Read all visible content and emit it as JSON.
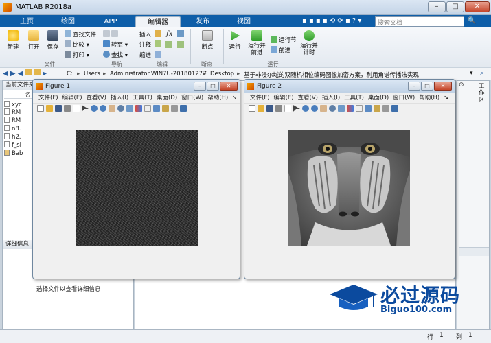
{
  "window": {
    "title": "MATLAB R2018a",
    "minimize": "–",
    "maximize": "□",
    "close": "✕"
  },
  "tabs": [
    "主页",
    "绘图",
    "APP",
    "编辑器",
    "发布",
    "视图"
  ],
  "search": {
    "placeholder": "搜索文档"
  },
  "ribbon": {
    "new": "新建",
    "open": "打开",
    "save": "保存",
    "find_files": "查找文件",
    "compare": "比较",
    "print": "打印",
    "goto": "转至",
    "find": "查找",
    "insert": "插入",
    "comment": "注释",
    "indent": "缩进",
    "breakpoints": "断点",
    "run": "运行",
    "run_advance": "运行并前进",
    "run_section": "运行节",
    "advance": "前进",
    "run_time": "运行并计时",
    "group_file": "文件",
    "group_navigate": "导航",
    "group_edit": "编辑",
    "group_breakpoints": "断点",
    "group_run": "运行"
  },
  "path": {
    "drive": "C:",
    "users": "Users",
    "admin": "Administrator.WIN7U-20180127Z",
    "desktop": "Desktop",
    "folder": "基于非浸尔域的双随机相位编码图像加密方案，利用角谱传播法实现"
  },
  "left_panel": {
    "header": "当前文件夹",
    "col_name": "名",
    "files": [
      "xyc",
      "RM",
      "RM",
      "n8.",
      "h2.",
      "f_si",
      "Bab"
    ],
    "details_header": "详细信息",
    "details_msg": "选择文件以查看详细信息"
  },
  "right_panel": {
    "label": "工作区"
  },
  "figure1": {
    "title": "Figure 1"
  },
  "figure2": {
    "title": "Figure 2"
  },
  "fig_menu": [
    "文件(F)",
    "编辑(E)",
    "查看(V)",
    "插入(I)",
    "工具(T)",
    "桌面(D)",
    "窗口(W)",
    "帮助(H)"
  ],
  "status": {
    "row_label": "行",
    "row": "1",
    "col_label": "列",
    "col": "1"
  },
  "watermark": {
    "name": "必过源码",
    "url": "Biguo100.com"
  },
  "colors": {
    "ribbon_tab": "#0e5ea8",
    "brand_orange": "#f7a400",
    "logo_blue": "#0b4a9e"
  }
}
